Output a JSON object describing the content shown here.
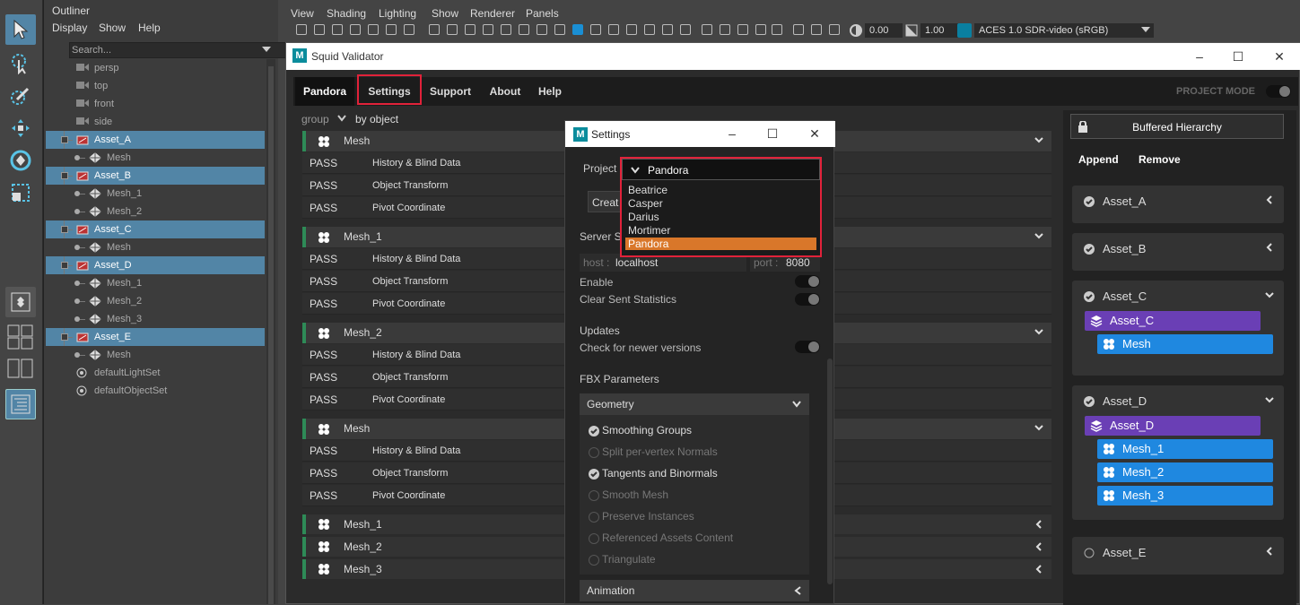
{
  "outliner": {
    "title": "Outliner",
    "menu": [
      "Display",
      "Show",
      "Help"
    ],
    "search_placeholder": "Search...",
    "items": [
      {
        "label": "persp",
        "indent": 0,
        "icon": "camera-icon",
        "selected": false
      },
      {
        "label": "top",
        "indent": 0,
        "icon": "camera-icon",
        "selected": false
      },
      {
        "label": "front",
        "indent": 0,
        "icon": "camera-icon",
        "selected": false
      },
      {
        "label": "side",
        "indent": 0,
        "icon": "camera-icon",
        "selected": false
      },
      {
        "label": "Asset_A",
        "indent": 0,
        "icon": "transform-icon",
        "selected": true
      },
      {
        "label": "Mesh",
        "indent": 1,
        "icon": "mesh-icon",
        "selected": false
      },
      {
        "label": "Asset_B",
        "indent": 0,
        "icon": "transform-icon",
        "selected": true
      },
      {
        "label": "Mesh_1",
        "indent": 1,
        "icon": "mesh-icon",
        "selected": false
      },
      {
        "label": "Mesh_2",
        "indent": 1,
        "icon": "mesh-icon",
        "selected": false
      },
      {
        "label": "Asset_C",
        "indent": 0,
        "icon": "transform-icon",
        "selected": true
      },
      {
        "label": "Mesh",
        "indent": 1,
        "icon": "mesh-icon",
        "selected": false
      },
      {
        "label": "Asset_D",
        "indent": 0,
        "icon": "transform-icon",
        "selected": true
      },
      {
        "label": "Mesh_1",
        "indent": 1,
        "icon": "mesh-icon",
        "selected": false
      },
      {
        "label": "Mesh_2",
        "indent": 1,
        "icon": "mesh-icon",
        "selected": false
      },
      {
        "label": "Mesh_3",
        "indent": 1,
        "icon": "mesh-icon",
        "selected": false
      },
      {
        "label": "Asset_E",
        "indent": 0,
        "icon": "transform-icon",
        "selected": true
      },
      {
        "label": "Mesh",
        "indent": 1,
        "icon": "mesh-icon",
        "selected": false
      },
      {
        "label": "defaultLightSet",
        "indent": 0,
        "icon": "set-icon",
        "selected": false
      },
      {
        "label": "defaultObjectSet",
        "indent": 0,
        "icon": "set-icon",
        "selected": false
      }
    ]
  },
  "viewport": {
    "menu": [
      "View",
      "Shading",
      "Lighting",
      "Show",
      "Renderer",
      "Panels"
    ],
    "exposure": "0.00",
    "gamma": "1.00",
    "colorspace": "ACES 1.0 SDR-video (sRGB)"
  },
  "app": {
    "title": "Squid Validator",
    "tabs": [
      "Pandora",
      "Settings",
      "Support",
      "About",
      "Help"
    ],
    "project_mode_label": "PROJECT MODE",
    "group_label": "group",
    "group_value": "by object"
  },
  "report": {
    "groups": [
      {
        "name": "Mesh",
        "checks": [
          {
            "status": "PASS",
            "name": "History & Blind Data"
          },
          {
            "status": "PASS",
            "name": "Object Transform"
          },
          {
            "status": "PASS",
            "name": "Pivot Coordinate"
          }
        ]
      },
      {
        "name": "Mesh_1",
        "checks": [
          {
            "status": "PASS",
            "name": "History & Blind Data"
          },
          {
            "status": "PASS",
            "name": "Object Transform"
          },
          {
            "status": "PASS",
            "name": "Pivot Coordinate"
          }
        ]
      },
      {
        "name": "Mesh_2",
        "checks": [
          {
            "status": "PASS",
            "name": "History & Blind Data"
          },
          {
            "status": "PASS",
            "name": "Object Transform"
          },
          {
            "status": "PASS",
            "name": "Pivot Coordinate"
          }
        ]
      },
      {
        "name": "Mesh",
        "checks": [
          {
            "status": "PASS",
            "name": "History & Blind Data"
          },
          {
            "status": "PASS",
            "name": "Object Transform"
          },
          {
            "status": "PASS",
            "name": "Pivot Coordinate"
          }
        ]
      }
    ],
    "collapsed": [
      "Mesh_1",
      "Mesh_2",
      "Mesh_3"
    ]
  },
  "right": {
    "buffer_label": "Buffered Hierarchy",
    "append_label": "Append",
    "remove_label": "Remove",
    "assets": [
      {
        "name": "Asset_A",
        "expanded": false,
        "checked": true
      },
      {
        "name": "Asset_B",
        "expanded": false,
        "checked": true
      },
      {
        "name": "Asset_C",
        "expanded": true,
        "checked": true,
        "children": [
          "Mesh"
        ]
      },
      {
        "name": "Asset_D",
        "expanded": true,
        "checked": true,
        "children": [
          "Mesh_1",
          "Mesh_2",
          "Mesh_3"
        ]
      },
      {
        "name": "Asset_E",
        "expanded": false,
        "checked": false
      }
    ]
  },
  "settings": {
    "title": "Settings",
    "project_label": "Project",
    "project_value": "Pandora",
    "project_options": [
      "Beatrice",
      "Casper",
      "Darius",
      "Mortimer",
      "Pandora"
    ],
    "create_label": "Creat",
    "server_label": "Server S",
    "host_label": "host :",
    "host_value": "localhost",
    "port_label": "port :",
    "port_value": "8080",
    "enable_label": "Enable",
    "clear_label": "Clear Sent Statistics",
    "updates_label": "Updates",
    "check_updates_label": "Check for newer versions",
    "fbx_label": "FBX Parameters",
    "geometry_label": "Geometry",
    "geometry_options": [
      {
        "label": "Smoothing Groups",
        "on": true
      },
      {
        "label": "Split per-vertex Normals",
        "on": false
      },
      {
        "label": "Tangents and Binormals",
        "on": true
      },
      {
        "label": "Smooth Mesh",
        "on": false
      },
      {
        "label": "Preserve Instances",
        "on": false
      },
      {
        "label": "Referenced Assets Content",
        "on": false
      },
      {
        "label": "Triangulate",
        "on": false
      }
    ],
    "animation_label": "Animation"
  },
  "colors": {
    "accent": "#d9772a",
    "highlight": "#e1223a",
    "selection": "#5285a6",
    "pass": "#2e8b57",
    "purple": "#6a3fb5",
    "blue": "#1f88e0"
  }
}
